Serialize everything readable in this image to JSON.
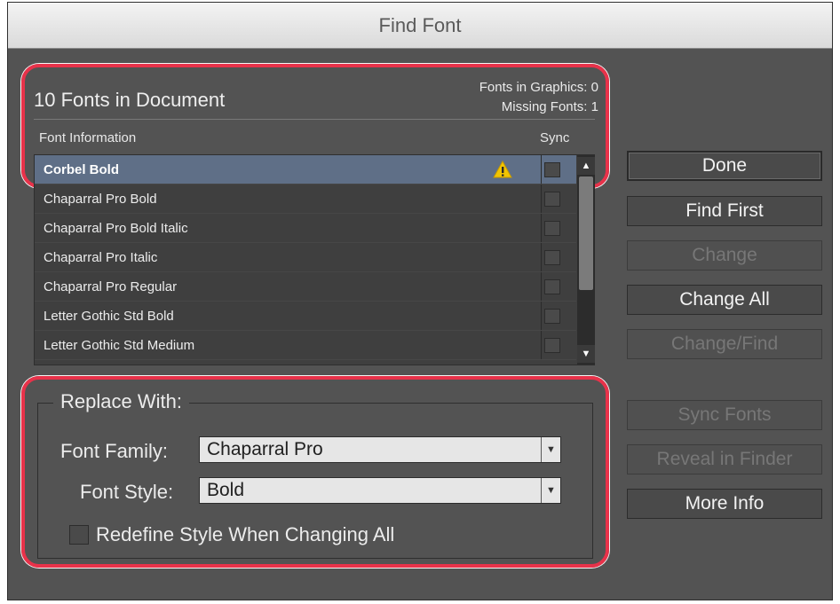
{
  "window": {
    "title": "Find Font"
  },
  "summary": {
    "fonts_in_document": "10 Fonts in Document",
    "fonts_in_graphics": "Fonts in Graphics: 0",
    "missing_fonts": "Missing Fonts: 1"
  },
  "table": {
    "col_font": "Font Information",
    "col_sync": "Sync",
    "rows": [
      {
        "name": "Corbel Bold",
        "selected": true,
        "warning": true
      },
      {
        "name": "Chaparral Pro Bold"
      },
      {
        "name": "Chaparral Pro Bold Italic"
      },
      {
        "name": "Chaparral Pro Italic"
      },
      {
        "name": "Chaparral Pro Regular"
      },
      {
        "name": "Letter Gothic Std Bold"
      },
      {
        "name": "Letter Gothic Std Medium"
      }
    ]
  },
  "replace": {
    "title": "Replace With:",
    "family_label": "Font Family:",
    "family_value": "Chaparral Pro",
    "style_label": "Font Style:",
    "style_value": "Bold",
    "redefine_label": "Redefine Style When Changing All"
  },
  "buttons": {
    "done": "Done",
    "find_first": "Find First",
    "change": "Change",
    "change_all": "Change All",
    "change_find": "Change/Find",
    "sync_fonts": "Sync Fonts",
    "reveal_in_finder": "Reveal in Finder",
    "more_info": "More Info"
  },
  "colors": {
    "highlight": "#e8324a",
    "dialog_bg": "#535353",
    "selected_row": "#5f6f87",
    "warning": "#f2c500"
  }
}
